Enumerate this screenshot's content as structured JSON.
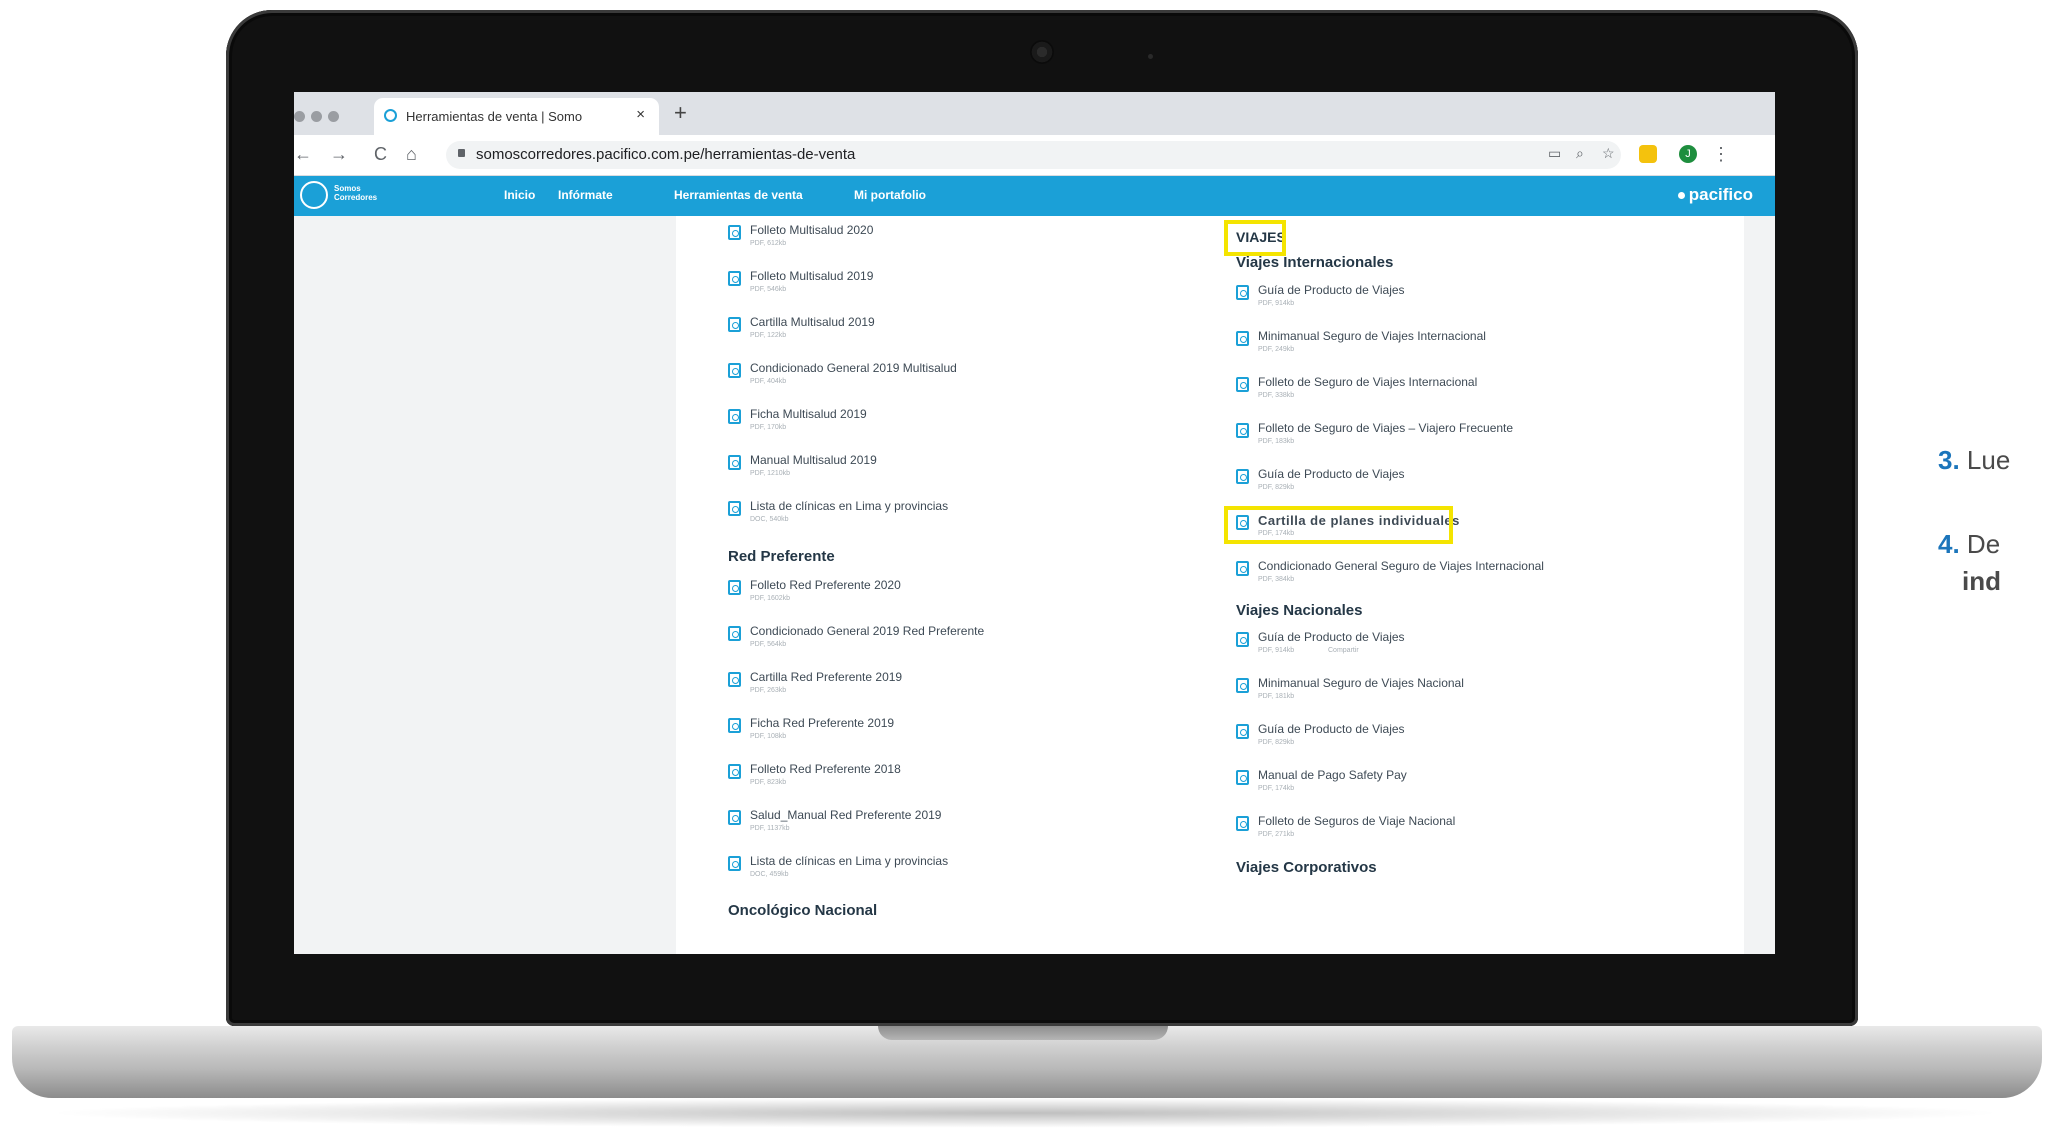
{
  "browser": {
    "tab_title": "Herramientas de venta | Somo",
    "tab_close": "×",
    "new_tab": "+",
    "url": "somoscorredores.pacifico.com.pe/herramientas-de-venta",
    "back": "←",
    "forward": "→",
    "reload": "C",
    "home": "⌂",
    "profile_initial": "J",
    "menu": "⋮"
  },
  "site": {
    "logo_text": "Somos Corredores",
    "nav": [
      "Inicio",
      "Infórmate",
      "Herramientas de venta",
      "Mi portafolio"
    ],
    "brand": "pacifico"
  },
  "left_column": {
    "items": [
      {
        "label": "Folleto Multisalud 2020",
        "meta": "PDF, 612kb"
      },
      {
        "label": "Folleto Multisalud 2019",
        "meta": "PDF, 546kb"
      },
      {
        "label": "Cartilla Multisalud 2019",
        "meta": "PDF, 122kb"
      },
      {
        "label": "Condicionado General 2019 Multisalud",
        "meta": "PDF, 404kb"
      },
      {
        "label": "Ficha Multisalud 2019",
        "meta": "PDF, 170kb"
      },
      {
        "label": "Manual Multisalud 2019",
        "meta": "PDF, 1210kb"
      },
      {
        "label": "Lista de clínicas en Lima y provincias",
        "meta": "DOC, 540kb"
      }
    ],
    "section2_title": "Red Preferente",
    "items2": [
      {
        "label": "Folleto Red Preferente 2020",
        "meta": "PDF, 1602kb"
      },
      {
        "label": "Condicionado General 2019 Red Preferente",
        "meta": "PDF, 564kb"
      },
      {
        "label": "Cartilla Red Preferente 2019",
        "meta": "PDF, 263kb"
      },
      {
        "label": "Ficha Red Preferente 2019",
        "meta": "PDF, 108kb"
      },
      {
        "label": "Folleto Red Preferente 2018",
        "meta": "PDF, 823kb"
      },
      {
        "label": "Salud_Manual Red Preferente 2019",
        "meta": "PDF, 1137kb"
      },
      {
        "label": "Lista de clínicas en Lima y provincias",
        "meta": "DOC, 459kb"
      }
    ],
    "section3_title": "Oncológico Nacional"
  },
  "right_column": {
    "category": "VIAJES",
    "sub1": "Viajes Internacionales",
    "items1": [
      {
        "label": "Guía de Producto de Viajes",
        "meta": "PDF, 914kb"
      },
      {
        "label": "Minimanual Seguro de Viajes Internacional",
        "meta": "PDF, 249kb"
      },
      {
        "label": "Folleto de Seguro de Viajes Internacional",
        "meta": "PDF, 338kb"
      },
      {
        "label": "Folleto de Seguro de Viajes – Viajero Frecuente",
        "meta": "PDF, 183kb"
      },
      {
        "label": "Guía de Producto de Viajes",
        "meta": "PDF, 829kb"
      },
      {
        "label": "Cartilla de planes individuales",
        "meta": "PDF, 174kb"
      },
      {
        "label": "Condicionado General Seguro de Viajes Internacional",
        "meta": "PDF, 384kb"
      }
    ],
    "sub2": "Viajes Nacionales",
    "items2": [
      {
        "label": "Guía de Producto de Viajes",
        "meta": "PDF, 914kb",
        "share": "Compartir"
      },
      {
        "label": "Minimanual Seguro de Viajes Nacional",
        "meta": "PDF, 181kb"
      },
      {
        "label": "Guía de Producto de Viajes",
        "meta": "PDF, 829kb"
      },
      {
        "label": "Manual de Pago Safety Pay",
        "meta": "PDF, 174kb"
      },
      {
        "label": "Folleto de Seguros de Viaje Nacional",
        "meta": "PDF, 271kb"
      }
    ],
    "sub3": "Viajes Corporativos"
  },
  "instructions": {
    "step3_num": "3.",
    "step3_text": "Lue",
    "step4_num": "4.",
    "step4_text": "De",
    "step4_bold": "ind"
  },
  "colors": {
    "brand_blue": "#1ba0d7",
    "highlight_yellow": "#f4e400",
    "step_blue": "#1b75bb"
  }
}
